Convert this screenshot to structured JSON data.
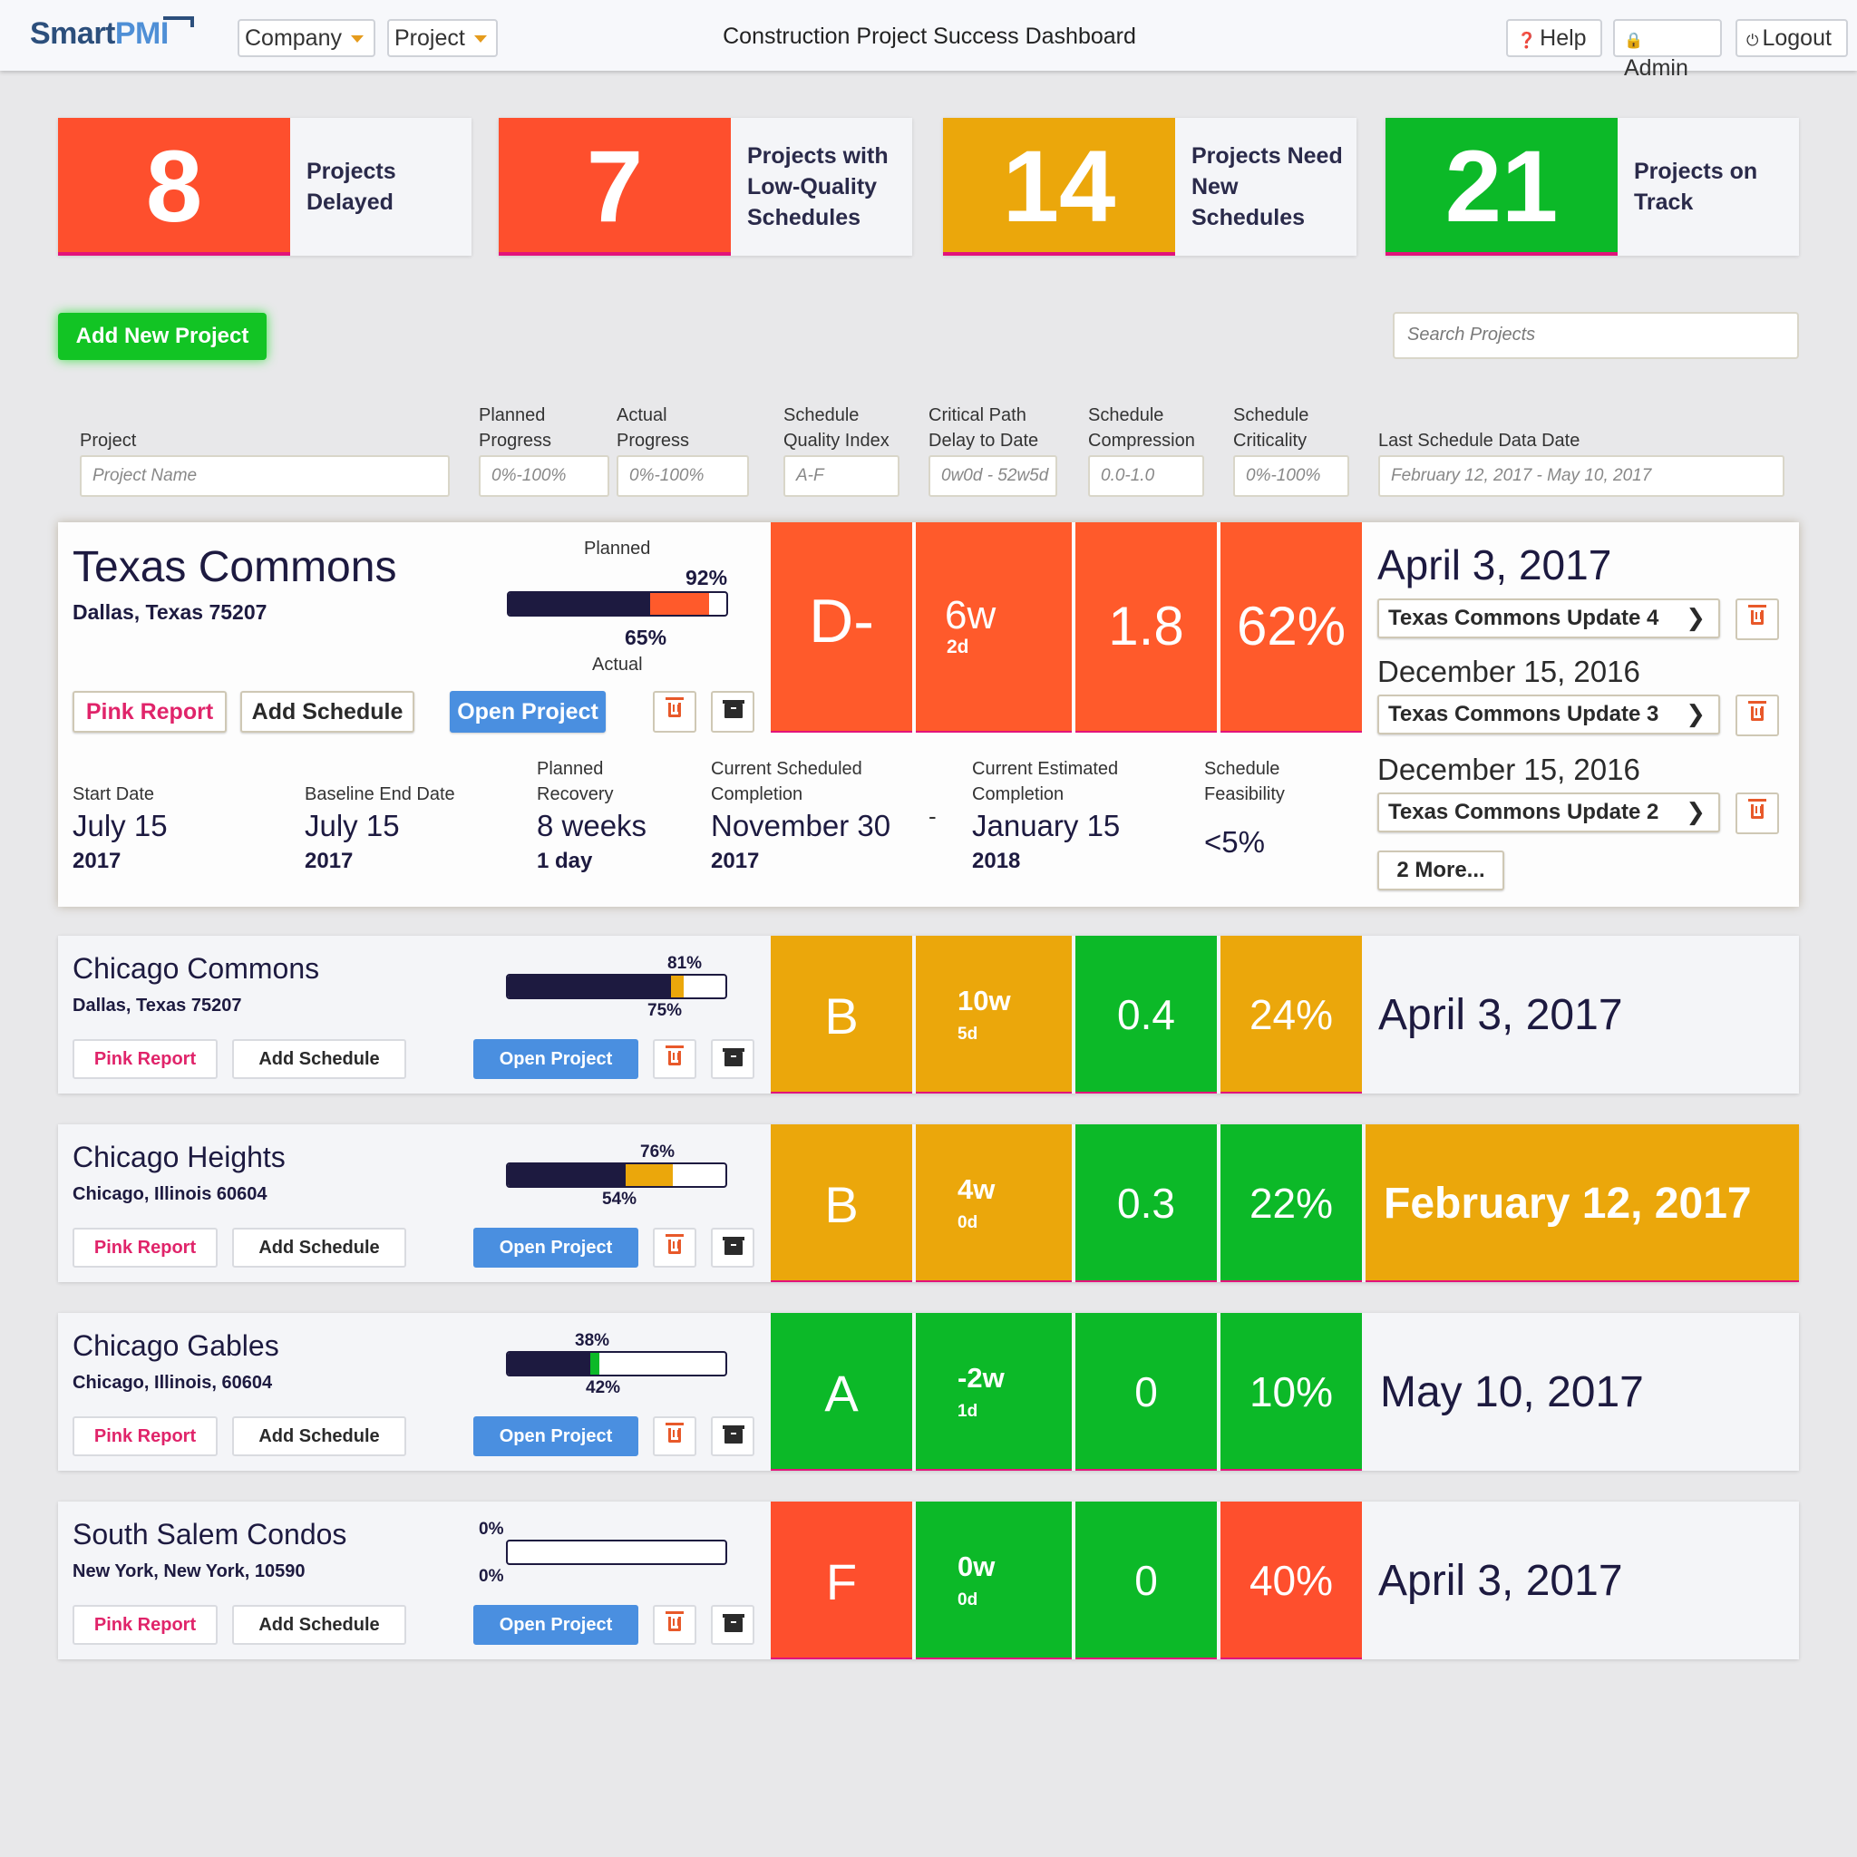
{
  "header": {
    "logo_smart": "Smart",
    "logo_pmi": "PMI",
    "company_label": "Company",
    "project_label": "Project",
    "title": "Construction Project Success Dashboard",
    "help_label": "Help",
    "admin_label": "Admin",
    "logout_label": "Logout"
  },
  "summary": [
    {
      "value": "8",
      "label": "Projects Delayed",
      "color": "#fe4f2d"
    },
    {
      "value": "7",
      "label": "Projects with Low-Quality Schedules",
      "color": "#fe4f2d"
    },
    {
      "value": "14",
      "label": "Projects Need New Schedules",
      "color": "#eba70b"
    },
    {
      "value": "21",
      "label": "Projects on Track",
      "color": "#0cb928"
    }
  ],
  "actions": {
    "add_project": "Add New Project",
    "search_placeholder": "Search Projects"
  },
  "filters": {
    "project": {
      "label": "Project",
      "placeholder": "Project Name"
    },
    "planned": {
      "label": "Planned Progress",
      "placeholder": "0%-100%"
    },
    "actual": {
      "label": "Actual Progress",
      "placeholder": "0%-100%"
    },
    "sqi": {
      "label": "Schedule Quality Index",
      "placeholder": "A-F"
    },
    "cpd": {
      "label": "Critical Path Delay to Date",
      "placeholder": "0w0d - 52w5d"
    },
    "compression": {
      "label": "Schedule Compression",
      "placeholder": "0.0-1.0"
    },
    "criticality": {
      "label": "Schedule Criticality",
      "placeholder": "0%-100%"
    },
    "last_date": {
      "label": "Last Schedule Data Date",
      "placeholder": "February 12, 2017 - May 10, 2017"
    }
  },
  "buttons": {
    "pink_report": "Pink Report",
    "add_schedule": "Add Schedule",
    "open_project": "Open Project"
  },
  "colors": {
    "red": "#fe4f2d",
    "amber": "#eba70b",
    "green": "#0cb928",
    "navy": "#1d1a40",
    "blue": "#4a8fe0"
  },
  "featured": {
    "name": "Texas Commons",
    "location": "Dallas, Texas 75207",
    "planned_caption": "Planned",
    "actual_caption": "Actual",
    "planned_pct": "92%",
    "actual_pct": "65%",
    "planned_value": 92,
    "actual_value": 65,
    "grade": "D-",
    "delay_weeks": "6w",
    "delay_days": "2d",
    "compression": "1.8",
    "criticality": "62%",
    "schedules": [
      {
        "date": "April 3, 2017",
        "update": "Texas Commons Update 4"
      },
      {
        "date": "December 15, 2016",
        "update": "Texas Commons Update 3"
      },
      {
        "date": "December 15, 2016",
        "update": "Texas Commons Update 2"
      }
    ],
    "more_label": "2 More...",
    "info": {
      "start_label": "Start Date",
      "start_value": "July 15",
      "start_year": "2017",
      "baseline_label": "Baseline End Date",
      "baseline_value": "July 15",
      "baseline_year": "2017",
      "recovery_label": "Planned Recovery",
      "recovery_value": "8 weeks",
      "recovery_sub": "1 day",
      "current_label": "Current Scheduled Completion",
      "current_value": "November 30",
      "current_year": "2017",
      "separator": "-",
      "estimated_label": "Current Estimated Completion",
      "estimated_value": "January 15",
      "estimated_year": "2018",
      "feasibility_label": "Schedule Feasibility",
      "feasibility_value": "<5%"
    }
  },
  "projects": [
    {
      "name": "Chicago Commons",
      "location": "Dallas, Texas 75207",
      "planned_pct": "81%",
      "actual_pct": "75%",
      "planned_value": 81,
      "actual_value": 75,
      "grade": "B",
      "delay_weeks": "10w",
      "delay_days": "5d",
      "compression": "0.4",
      "criticality": "24%",
      "date": "April 3, 2017"
    },
    {
      "name": "Chicago Heights",
      "location": "Chicago, Illinois 60604",
      "planned_pct": "76%",
      "actual_pct": "54%",
      "planned_value": 76,
      "actual_value": 54,
      "grade": "B",
      "delay_weeks": "4w",
      "delay_days": "0d",
      "compression": "0.3",
      "criticality": "22%",
      "date": "February 12, 2017"
    },
    {
      "name": "Chicago Gables",
      "location": "Chicago, Illinois, 60604",
      "planned_pct": "38%",
      "actual_pct": "42%",
      "planned_value": 38,
      "actual_value": 42,
      "grade": "A",
      "delay_weeks": "-2w",
      "delay_days": "1d",
      "compression": "0",
      "criticality": "10%",
      "date": "May 10, 2017"
    },
    {
      "name": "South Salem Condos",
      "location": "New York, New York, 10590",
      "planned_pct": "0%",
      "actual_pct": "0%",
      "planned_value": 0,
      "actual_value": 0,
      "grade": "F",
      "delay_weeks": "0w",
      "delay_days": "0d",
      "compression": "0",
      "criticality": "40%",
      "date": "April 3, 2017"
    }
  ]
}
